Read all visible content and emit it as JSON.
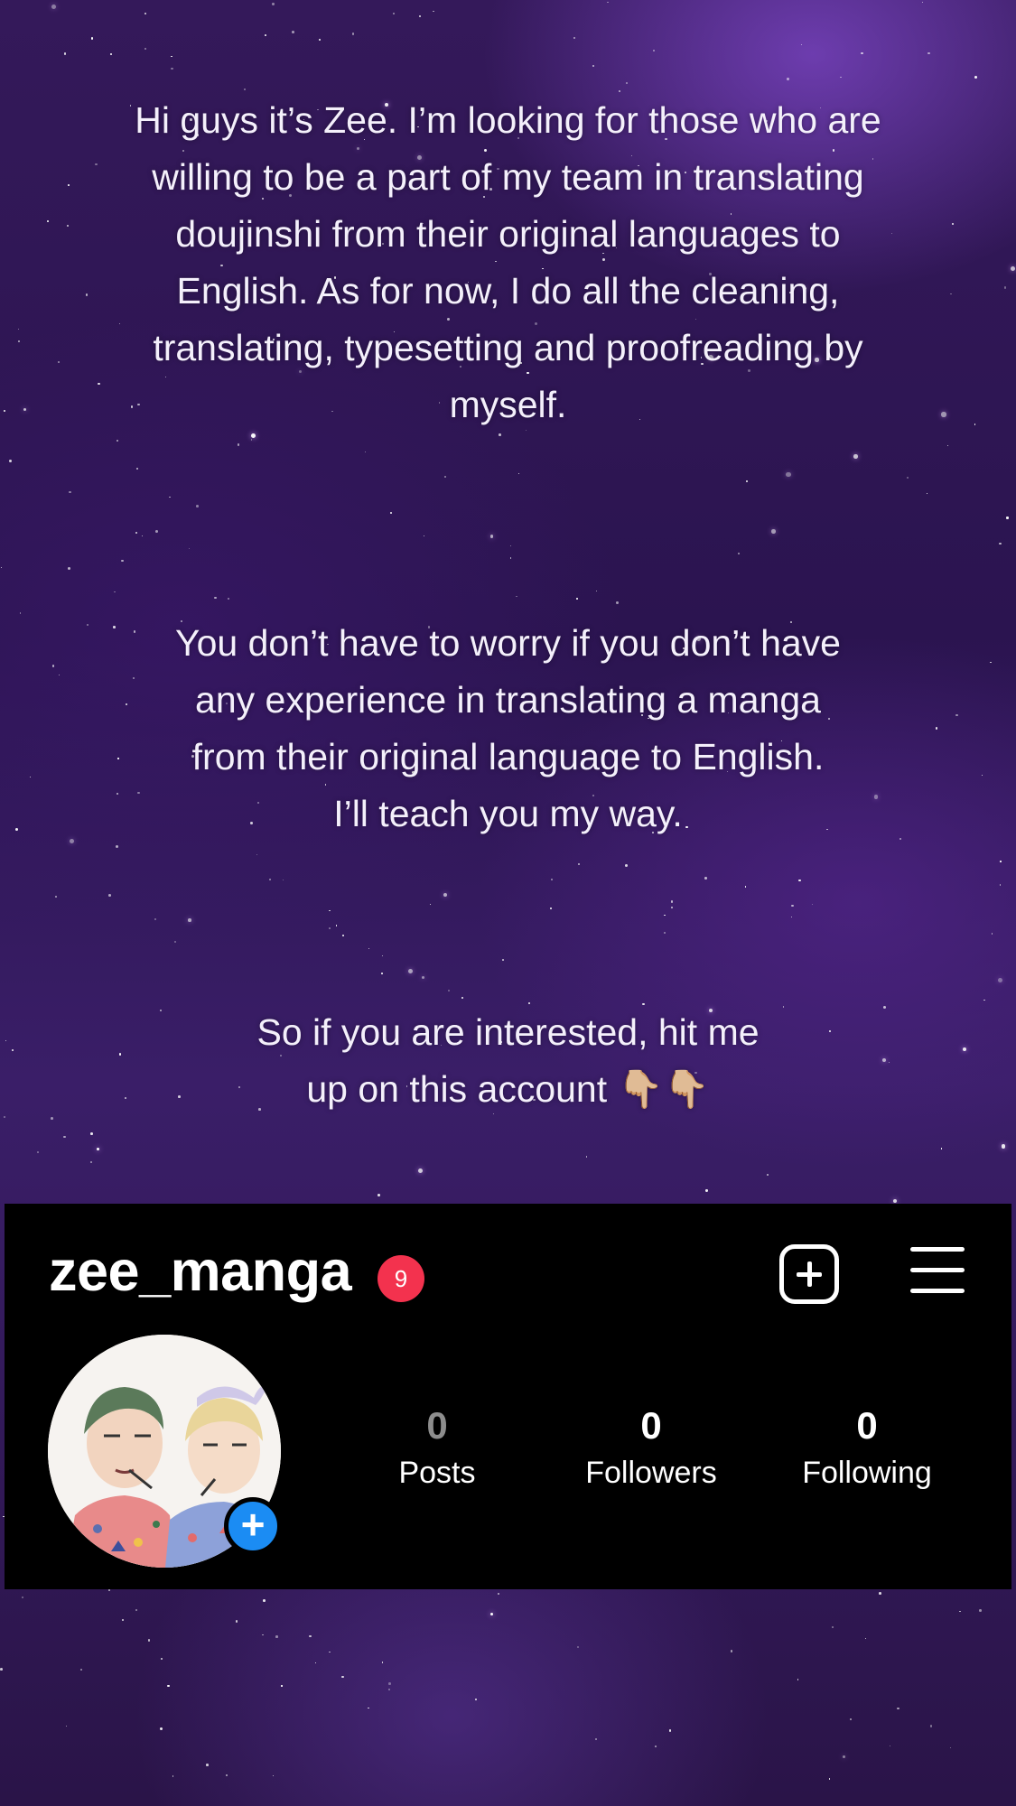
{
  "story": {
    "paragraph1": "Hi guys it’s Zee. I’m looking for those who are willing to be a part of my team in translating doujinshi from their original languages to English. As for now, I do all the cleaning, translating, typesetting and proofreading by myself.",
    "paragraph2": "You don’t have to worry if you don’t have any experience in translating a manga from their original language to English. I’ll teach you my way.",
    "paragraph3": "So if you are interested, hit me up on this account",
    "paragraph3_emoji": "👇🏼👇🏼"
  },
  "profile": {
    "username": "zee_manga",
    "notification_count": "9",
    "stats": [
      {
        "value": "0",
        "label": "Posts"
      },
      {
        "value": "0",
        "label": "Followers"
      },
      {
        "value": "0",
        "label": "Following"
      }
    ],
    "avatar_add": "+"
  },
  "icons": {
    "add_post": "plus-square-icon",
    "menu": "hamburger-menu-icon"
  },
  "colors": {
    "badge": "#f3324e",
    "avatar_add": "#1b8cf3",
    "card_bg": "#000000"
  }
}
